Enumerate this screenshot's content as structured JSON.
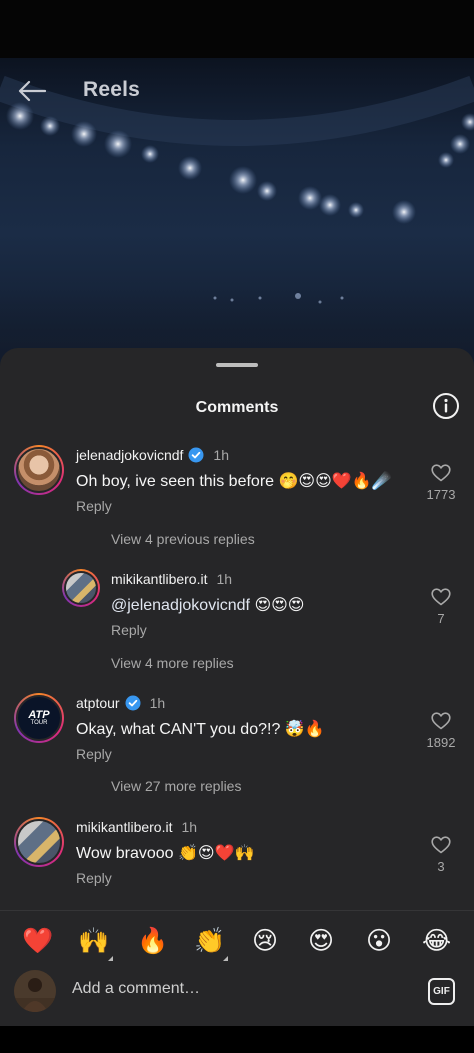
{
  "header": {
    "title": "Reels",
    "back_icon": "arrow-left-icon"
  },
  "sheet": {
    "title": "Comments",
    "info_icon": "info-circle-icon"
  },
  "comments": [
    {
      "username": "jelenadjokovicndf",
      "verified": true,
      "time": "1h",
      "text": "Oh boy, ive seen this before 🤭😍😍❤️🔥☄️",
      "reply_label": "Reply",
      "likes": "1773",
      "view_more": "View 4 previous replies"
    },
    {
      "username": "mikikantlibero.it",
      "verified": false,
      "time": "1h",
      "mention": "@jelenadjokovicndf",
      "text": " 😍😍😍",
      "reply_label": "Reply",
      "likes": "7",
      "view_more": "View 4 more replies"
    },
    {
      "username": "atptour",
      "verified": true,
      "time": "1h",
      "text": "Okay, what CAN'T you do?!? 🤯🔥",
      "reply_label": "Reply",
      "likes": "1892",
      "view_more": "View 27 more replies",
      "avatar_text": "ATP TOUR"
    },
    {
      "username": "mikikantlibero.it",
      "verified": false,
      "time": "1h",
      "text": "Wow bravooo 👏😍❤️🙌",
      "reply_label": "Reply",
      "likes": "3"
    }
  ],
  "emoji_bar": [
    "❤️",
    "🙌",
    "🔥",
    "👏",
    "😢",
    "😍",
    "😮",
    "😂"
  ],
  "input": {
    "placeholder": "Add a comment…",
    "gif_label": "GIF"
  },
  "colors": {
    "sheet_bg": "#262628",
    "verified_blue": "#3897f0",
    "muted": "#a8a8a8"
  }
}
